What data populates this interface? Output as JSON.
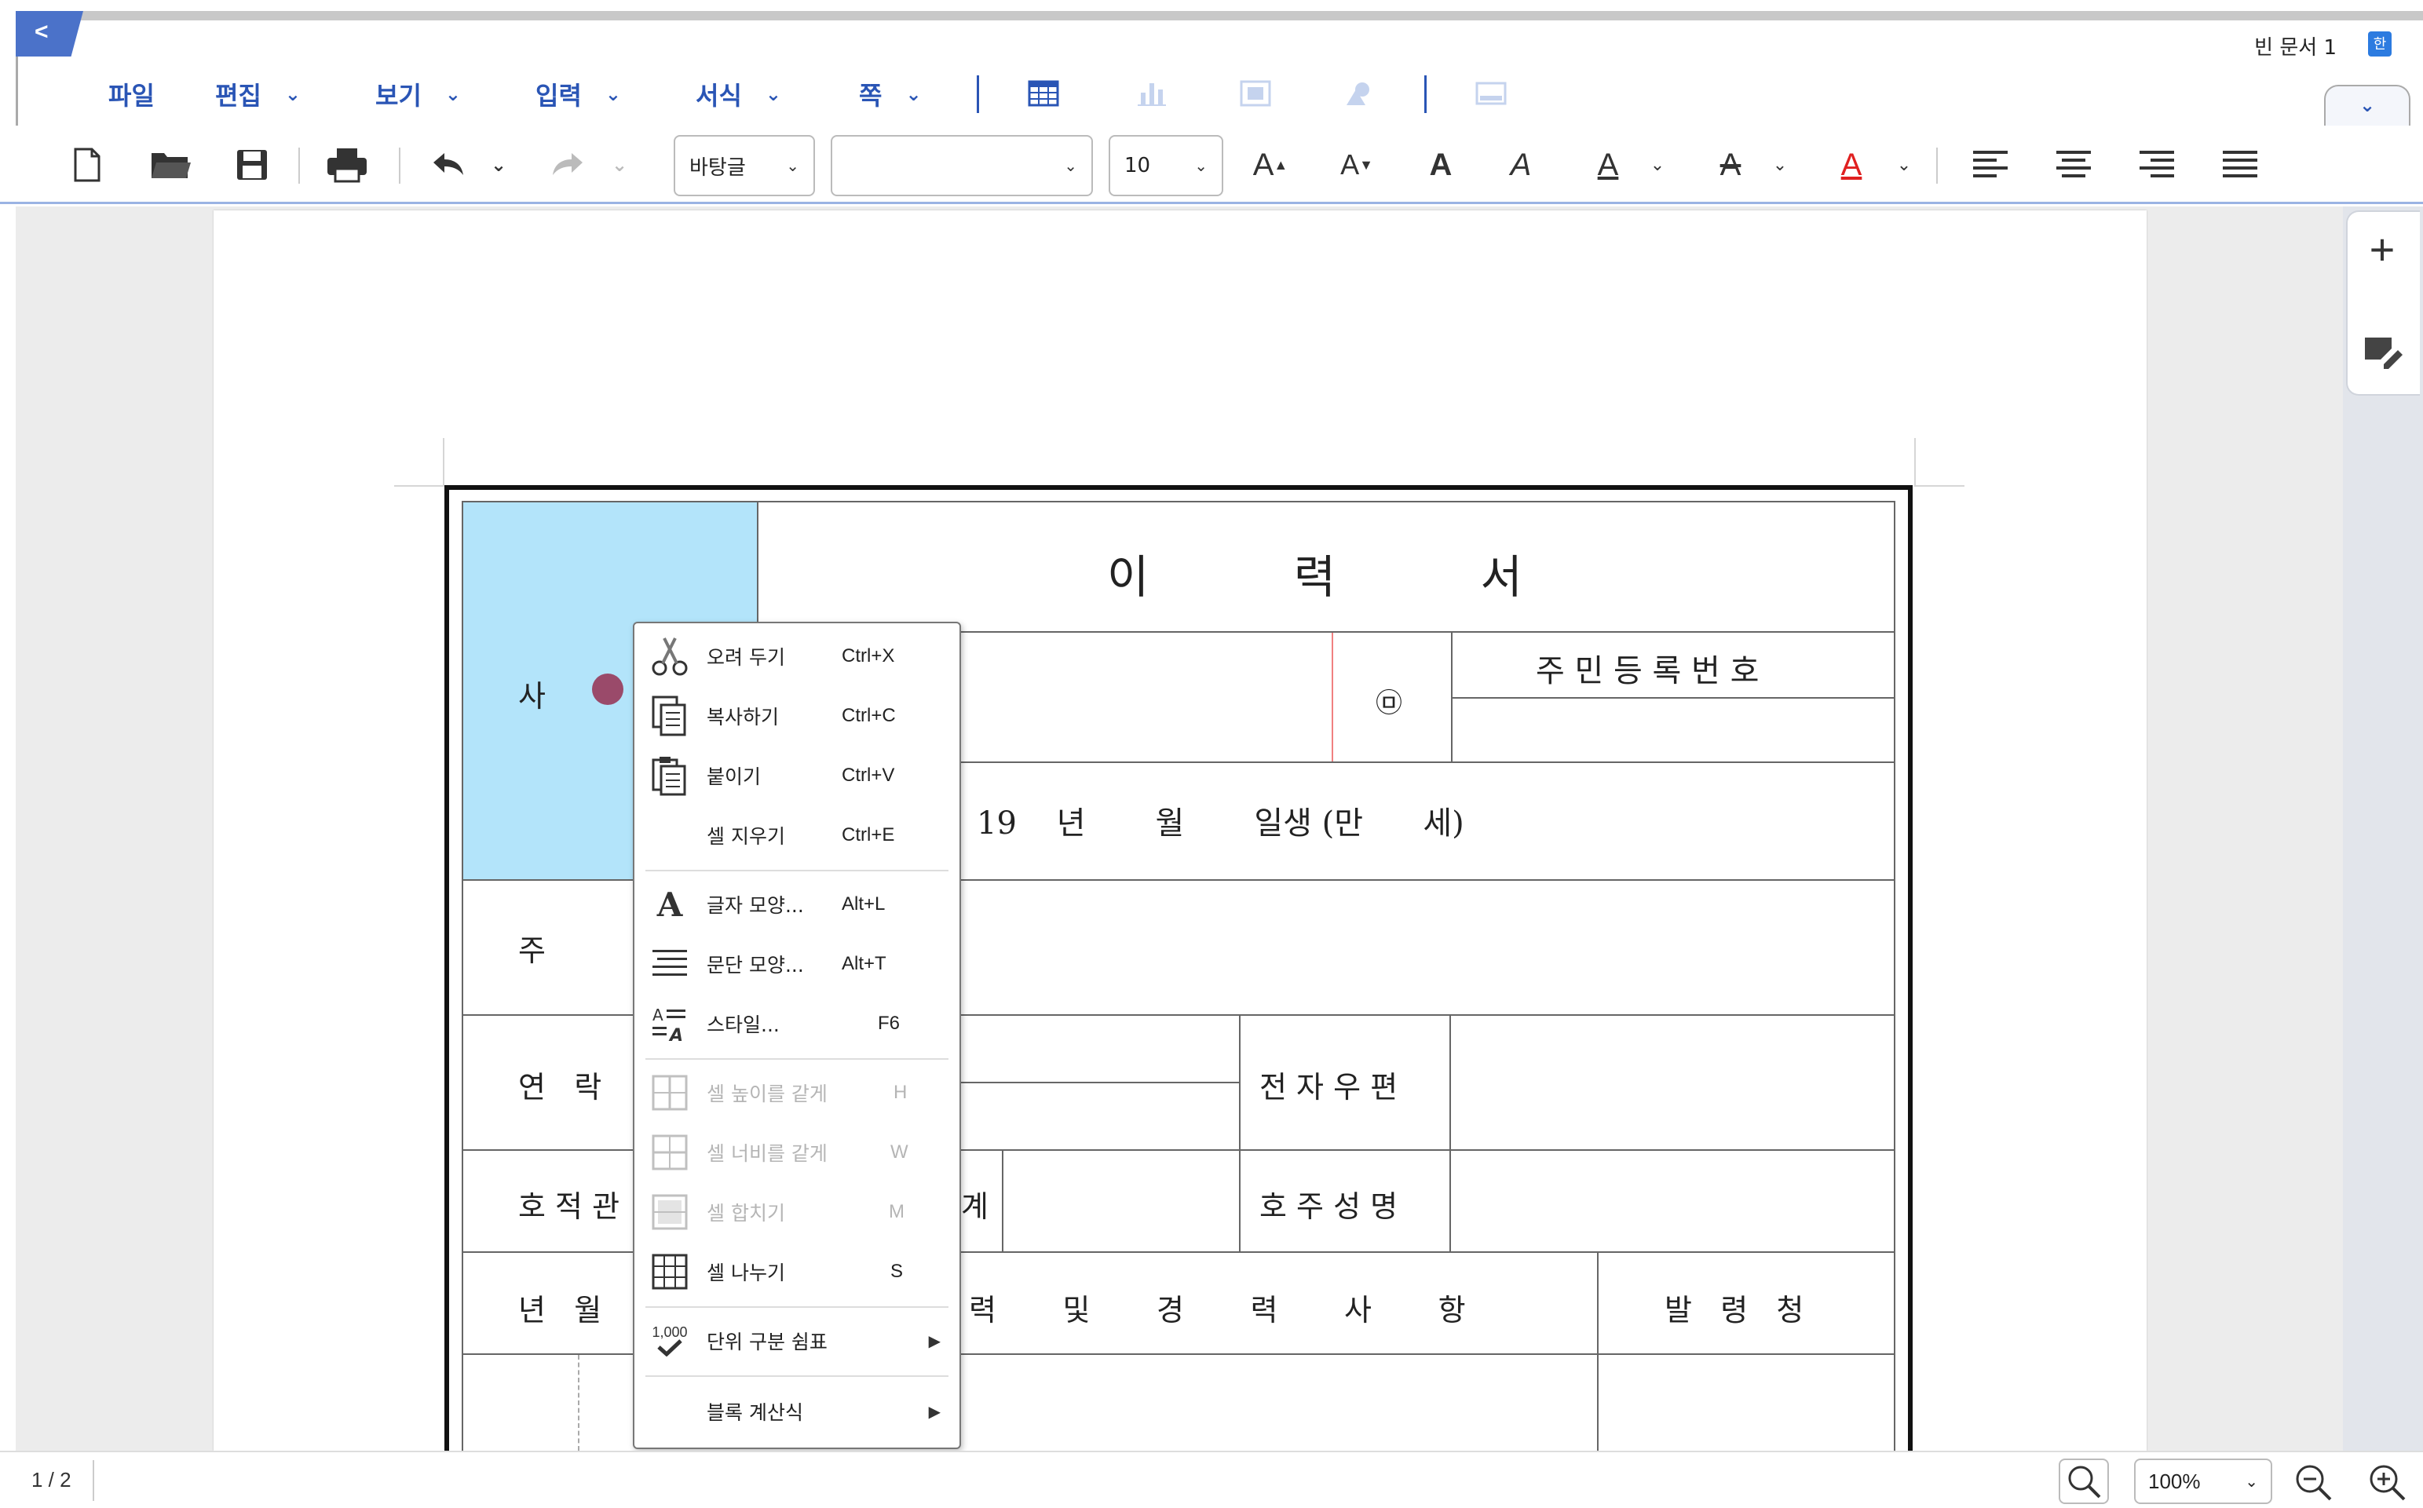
{
  "app": {
    "back_label": "<",
    "doc_title": "빈 문서 1",
    "doc_badge": "한",
    "collapse_label": "⌄"
  },
  "menu": {
    "file": "파일",
    "edit": "편집",
    "view": "보기",
    "insert": "입력",
    "format": "서식",
    "page": "쪽",
    "chevron": "⌄"
  },
  "toolbar": {
    "font_face": "바탕글",
    "font_name": "",
    "font_size": "10",
    "grow_font": "A",
    "shrink_font": "A",
    "bold": "A",
    "italic": "A",
    "underline": "A",
    "strike": "A",
    "color_text": "A",
    "text_color": "#e02020",
    "accent_color": "#2a55b5"
  },
  "form": {
    "title": "이          력          서",
    "name_label": "사",
    "seal": "㉤",
    "resident_label": "주 민 등 록 번 호",
    "birth_line": "19    년       월       일생 (만      세)",
    "address_label": "주",
    "contact_label": "연   락",
    "email_label": "전 자 우 편",
    "registry_label": "호 적 관",
    "registry_tail": "계",
    "head_name_label": "호 주 성 명",
    "yearmonth_label": "년   월",
    "history_label": "력       및       경       력       사       항",
    "issuer_label": "발   령   청"
  },
  "context_menu": {
    "items": [
      {
        "label": "오려 두기",
        "shortcut": "Ctrl+X"
      },
      {
        "label": "복사하기",
        "shortcut": "Ctrl+C"
      },
      {
        "label": "붙이기",
        "shortcut": "Ctrl+V"
      },
      {
        "label": "셀 지우기",
        "shortcut": "Ctrl+E"
      },
      {
        "label": "글자 모양...",
        "shortcut": "Alt+L"
      },
      {
        "label": "문단 모양...",
        "shortcut": "Alt+T"
      },
      {
        "label": "스타일...",
        "shortcut": "F6"
      },
      {
        "label": "셀 높이를 같게",
        "shortcut": "H"
      },
      {
        "label": "셀 너비를 같게",
        "shortcut": "W"
      },
      {
        "label": "셀 합치기",
        "shortcut": "M"
      },
      {
        "label": "셀 나누기",
        "shortcut": "S"
      },
      {
        "label": "단위 구분 쉼표",
        "shortcut": ""
      },
      {
        "label": "블록 계산식",
        "shortcut": ""
      }
    ],
    "thousand_badge": "1,000"
  },
  "status": {
    "page_indicator": "1 / 2",
    "zoom_value": "100%"
  }
}
